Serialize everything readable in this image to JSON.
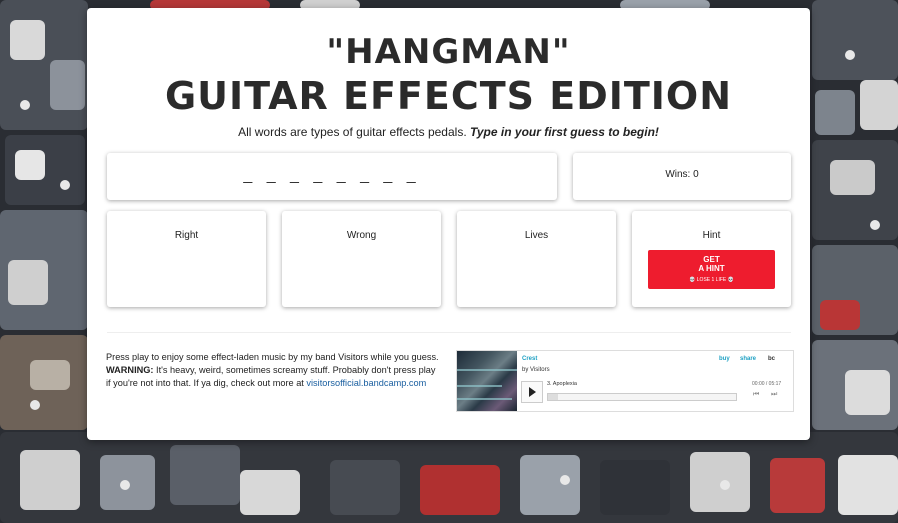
{
  "header": {
    "title_line1": "\"HANGMAN\"",
    "title_line2": "GUITAR EFFECTS EDITION",
    "subtitle_plain": "All words are types of guitar effects pedals.",
    "subtitle_emphasis": "Type in your first guess to begin!"
  },
  "game": {
    "word_blanks": "_ _ _ _ _ _ _ _",
    "wins_label": "Wins: 0",
    "panels": {
      "right_label": "Right",
      "wrong_label": "Wrong",
      "lives_label": "Lives",
      "hint_label": "Hint"
    },
    "hint_button": {
      "line1": "GET",
      "line2": "A HINT",
      "line3": "💀 LOSE 1 LIFE 💀"
    }
  },
  "about": {
    "text1": "Press play to enjoy some effect-laden music by my band Visitors while you guess.",
    "warning_label": "WARNING:",
    "text2": "It's heavy, weird, sometimes screamy stuff. Probably don't press play if you're not into that. If ya dig, check out more at",
    "link": "visitorsofficial.bandcamp.com"
  },
  "player": {
    "album": "Crest",
    "artist": "by Visitors",
    "buy": "buy",
    "share": "share",
    "logo": "bc",
    "track": "3.  Apoplexia",
    "time": "00:00 / 05:17",
    "prev_icon": "prev-icon",
    "next_icon": "next-icon",
    "play_icon": "play-icon"
  },
  "colors": {
    "hint_button": "#ee1c2e",
    "link": "#1a5fa0",
    "player_accent": "#1da0c3"
  }
}
